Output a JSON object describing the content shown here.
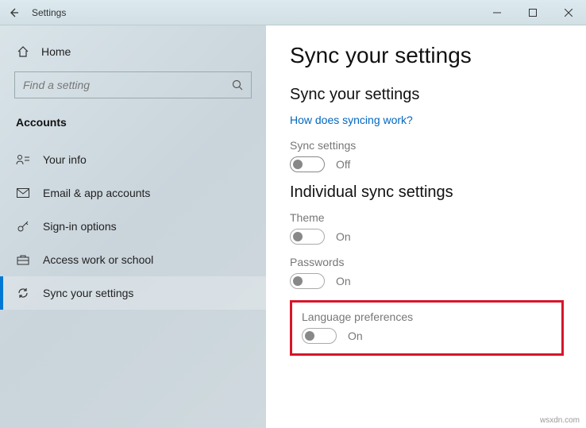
{
  "titlebar": {
    "title": "Settings"
  },
  "sidebar": {
    "home_label": "Home",
    "search_placeholder": "Find a setting",
    "category": "Accounts",
    "items": [
      {
        "label": "Your info"
      },
      {
        "label": "Email & app accounts"
      },
      {
        "label": "Sign-in options"
      },
      {
        "label": "Access work or school"
      },
      {
        "label": "Sync your settings"
      }
    ]
  },
  "main": {
    "title": "Sync your settings",
    "section1_heading": "Sync your settings",
    "help_link": "How does syncing work?",
    "sync_settings_label": "Sync settings",
    "sync_settings_state": "Off",
    "section2_heading": "Individual sync settings",
    "theme_label": "Theme",
    "theme_state": "On",
    "passwords_label": "Passwords",
    "passwords_state": "On",
    "lang_label": "Language preferences",
    "lang_state": "On"
  },
  "watermark": "wsxdn.com"
}
